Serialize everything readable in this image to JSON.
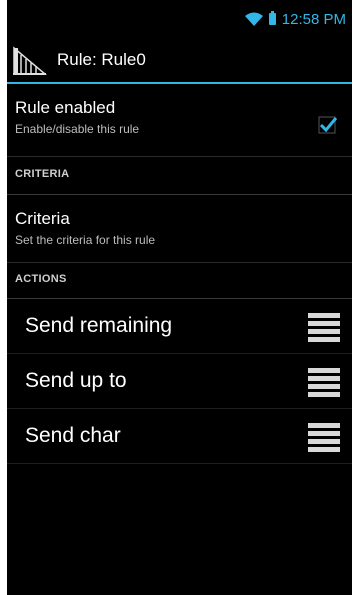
{
  "status_bar": {
    "time": "12:58 PM",
    "accent_color": "#33b5e5",
    "icons": [
      "wifi-icon",
      "battery-icon"
    ]
  },
  "action_bar": {
    "title": "Rule: Rule0",
    "icon": "app-icon"
  },
  "preferences": {
    "rule_enabled": {
      "title": "Rule enabled",
      "summary": "Enable/disable this rule",
      "checked": true
    },
    "criteria_header": "CRITERIA",
    "criteria": {
      "title": "Criteria",
      "summary": "Set the criteria for this rule"
    },
    "actions_header": "ACTIONS",
    "actions": [
      {
        "label": "Send remaining"
      },
      {
        "label": "Send up to"
      },
      {
        "label": "Send char"
      }
    ]
  }
}
